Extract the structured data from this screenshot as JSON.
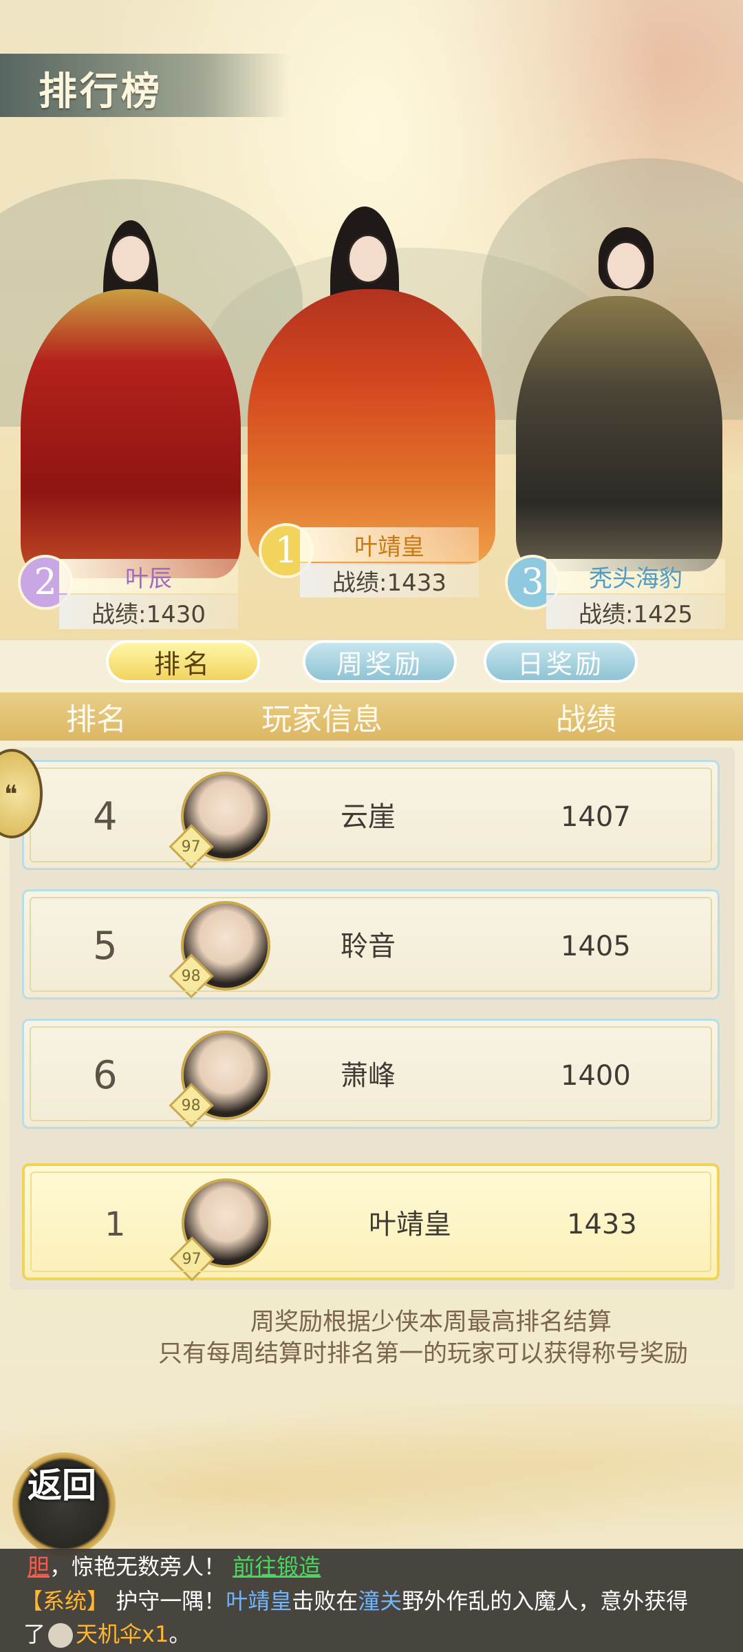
{
  "title": "排行榜",
  "podium": [
    {
      "rank": "1",
      "name": "叶靖皇",
      "score": "战绩:1433",
      "name_color": "#c77a13",
      "circle_color": "#f2d45d"
    },
    {
      "rank": "2",
      "name": "叶辰",
      "score": "战绩:1430",
      "name_color": "#9e6ac3",
      "circle_color": "#c9a6e4"
    },
    {
      "rank": "3",
      "name": "秃头海豹",
      "score": "战绩:1425",
      "name_color": "#4f9bc3",
      "circle_color": "#8ec9e0"
    }
  ],
  "tabs": [
    {
      "label": "排名",
      "active": true
    },
    {
      "label": "周奖励",
      "active": false
    },
    {
      "label": "日奖励",
      "active": false
    }
  ],
  "columns": {
    "rank": "排名",
    "info": "玩家信息",
    "score": "战绩"
  },
  "rows": [
    {
      "rank": "4",
      "level": "97",
      "name": "云崖",
      "score": "1407"
    },
    {
      "rank": "5",
      "level": "98",
      "name": "聆音",
      "score": "1405"
    },
    {
      "rank": "6",
      "level": "98",
      "name": "萧峰",
      "score": "1400"
    }
  ],
  "self_row": {
    "rank": "1",
    "level": "97",
    "name": "叶靖皇",
    "score": "1433"
  },
  "notes": [
    "周奖励根据少侠本周最高排名结算",
    "只有每周结算时排名第一的玩家可以获得称号奖励"
  ],
  "back_label": "返回",
  "ticker": {
    "line1_a": "胆",
    "line1_b": "，惊艳无数旁人！",
    "line1_link": "前往锻造",
    "line2_tag": "【系统】",
    "line2_a": "护守一隅！",
    "line2_name": "叶靖皇",
    "line2_b": "击败在",
    "line2_place": "潼关",
    "line2_c": "野外作乱的入魔人，意外获得",
    "line3_a": "了",
    "line3_item": "天机伞x1",
    "line3_b": "。"
  }
}
